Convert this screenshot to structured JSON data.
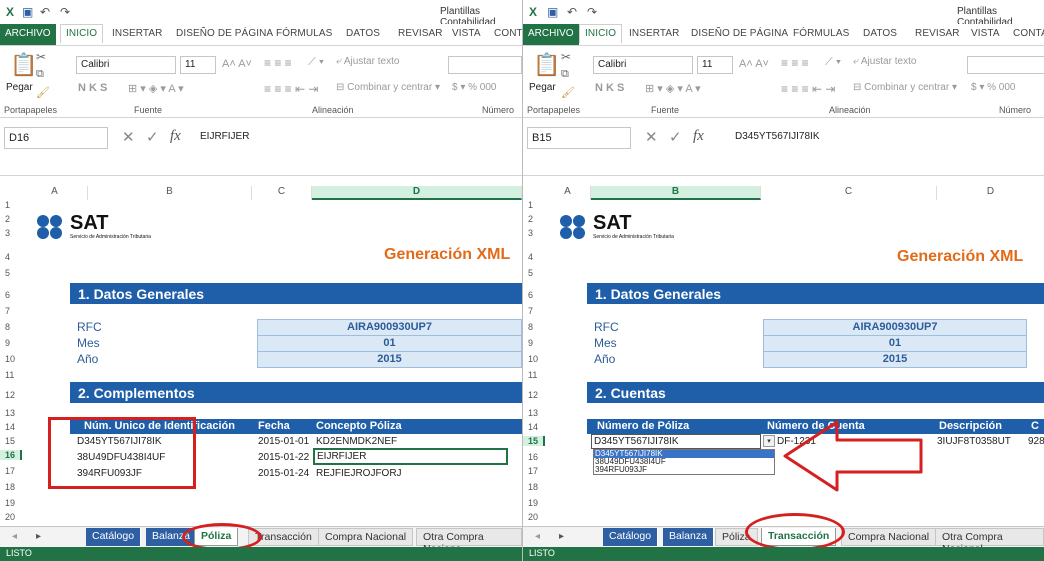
{
  "window_title": "Plantillas Contabilidad",
  "menu": {
    "file": "ARCHIVO",
    "items": [
      "INICIO",
      "INSERTAR",
      "DISEÑO DE PÁGINA",
      "FÓRMULAS",
      "DATOS",
      "REVISAR",
      "VISTA",
      "CONTA"
    ]
  },
  "ribbon": {
    "paste": "Pegar",
    "font_name": "Calibri",
    "font_size": "11",
    "bold_italic_underline": "N  K  S",
    "wrap_text": "Ajustar texto",
    "merge_center": "Combinar y centrar",
    "number_format": "$  ▾  %  000",
    "groups": {
      "clipboard": "Portapapeles",
      "font": "Fuente",
      "alignment": "Alineación",
      "number": "Número"
    }
  },
  "fx_label": "fx",
  "sat": {
    "logo": "SAT",
    "subtitle": "Servicio de Administración Tributaria"
  },
  "heading": "Generación XML",
  "section1": "1. Datos Generales",
  "labels": {
    "rfc": "RFC",
    "mes": "Mes",
    "anio": "Año"
  },
  "values": {
    "rfc": "AIRA900930UP7",
    "mes": "01",
    "anio": "2015"
  },
  "row_numbers": [
    "1",
    "2",
    "3",
    "4",
    "5",
    "6",
    "7",
    "8",
    "9",
    "10",
    "11",
    "12",
    "13",
    "14",
    "15",
    "16",
    "17",
    "18",
    "19",
    "20"
  ],
  "left": {
    "namebox": "D16",
    "formula": "EIJRFIJER",
    "columns": [
      "A",
      "B",
      "C",
      "D"
    ],
    "section2": "2. Complementos",
    "table_headers": [
      "Núm. Unico de Identificación",
      "Fecha",
      "Concepto Póliza"
    ],
    "rows": [
      {
        "id": "D345YT567IJI78IK",
        "fecha": "2015-01-01",
        "concepto": "KD2ENMDK2NEF"
      },
      {
        "id": "38U49DFU438I4UF",
        "fecha": "2015-01-22",
        "concepto": "EIJRFIJER"
      },
      {
        "id": "394RFU093JF",
        "fecha": "2015-01-24",
        "concepto": "REJFIEJROJFORJ"
      }
    ],
    "tabs": [
      "Catálogo",
      "Balanza",
      "Póliza",
      "Transacción",
      "Compra Nacional",
      "Otra Compra Naciona"
    ],
    "active_tab": "Póliza",
    "status": "LISTO"
  },
  "right": {
    "namebox": "B15",
    "formula": "D345YT567IJI78IK",
    "columns": [
      "A",
      "B",
      "C",
      "D"
    ],
    "section2": "2. Cuentas",
    "table_headers": [
      "Número de Póliza",
      "Número de Cuenta",
      "Descripción",
      "C"
    ],
    "row15": {
      "poliza": "D345YT567IJI78IK",
      "cuenta": "DF-1231",
      "descripcion": "3IUJF8T0358UT",
      "extra": "928"
    },
    "dropdown_options": [
      "D345YT567IJI78IK",
      "38U49DFU438I4UF",
      "394RFU093JF"
    ],
    "tabs": [
      "Catálogo",
      "Balanza",
      "Póliza",
      "Transacción",
      "Compra Nacional",
      "Otra Compra Nacional"
    ],
    "active_tab": "Transacción",
    "status": "LISTO"
  },
  "colors": {
    "excel_green": "#217346",
    "header_blue": "#1f5ea8",
    "accent_orange": "#e26b1a",
    "annotation_red": "#d62020",
    "value_fill": "#dbe9f7"
  }
}
